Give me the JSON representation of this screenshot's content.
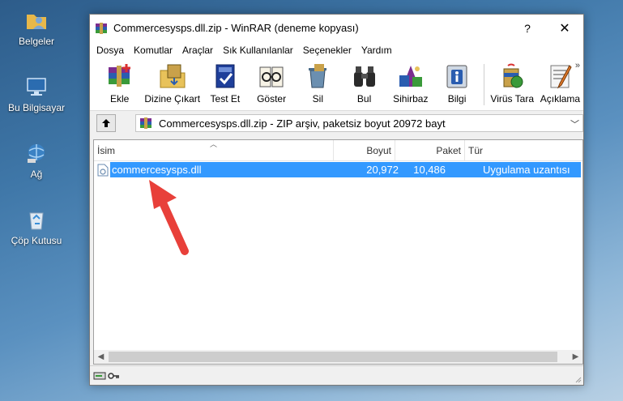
{
  "desktop": {
    "icons": [
      {
        "label": "Belgeler",
        "icon": "folder-user-icon"
      },
      {
        "label": "Bu Bilgisayar",
        "icon": "computer-icon"
      },
      {
        "label": "Ağ",
        "icon": "network-icon"
      },
      {
        "label": "Çöp Kutusu",
        "icon": "recycle-bin-icon"
      }
    ]
  },
  "window": {
    "title": "Commercesysps.dll.zip - WinRAR (deneme kopyası)",
    "help": "?",
    "close": "✕"
  },
  "menu": [
    "Dosya",
    "Komutlar",
    "Araçlar",
    "Sık Kullanılanlar",
    "Seçenekler",
    "Yardım"
  ],
  "toolbar": {
    "buttons": [
      {
        "label": "Ekle",
        "icon": "add-archive-icon"
      },
      {
        "label": "Dizine Çıkart",
        "icon": "extract-to-icon"
      },
      {
        "label": "Test Et",
        "icon": "test-icon"
      },
      {
        "label": "Göster",
        "icon": "view-icon"
      },
      {
        "label": "Sil",
        "icon": "delete-icon"
      },
      {
        "label": "Bul",
        "icon": "find-icon"
      },
      {
        "label": "Sihirbaz",
        "icon": "wizard-icon"
      },
      {
        "label": "Bilgi",
        "icon": "info-icon"
      },
      {
        "label": "Virüs Tara",
        "icon": "virus-scan-icon"
      },
      {
        "label": "Açıklama",
        "icon": "comment-icon"
      }
    ],
    "more": "»"
  },
  "address": {
    "text": "Commercesysps.dll.zip - ZIP arşiv, paketsiz boyut 20972 bayt"
  },
  "list": {
    "headers": {
      "name": "İsim",
      "size": "Boyut",
      "packed": "Paket",
      "type": "Tür"
    },
    "rows": [
      {
        "name": "commercesysps.dll",
        "size": "20,972",
        "packed": "10,486",
        "type": "Uygulama uzantısı",
        "selected": true
      }
    ]
  },
  "colors": {
    "selection": "#3399ff",
    "annotation_arrow": "#e8403a"
  }
}
